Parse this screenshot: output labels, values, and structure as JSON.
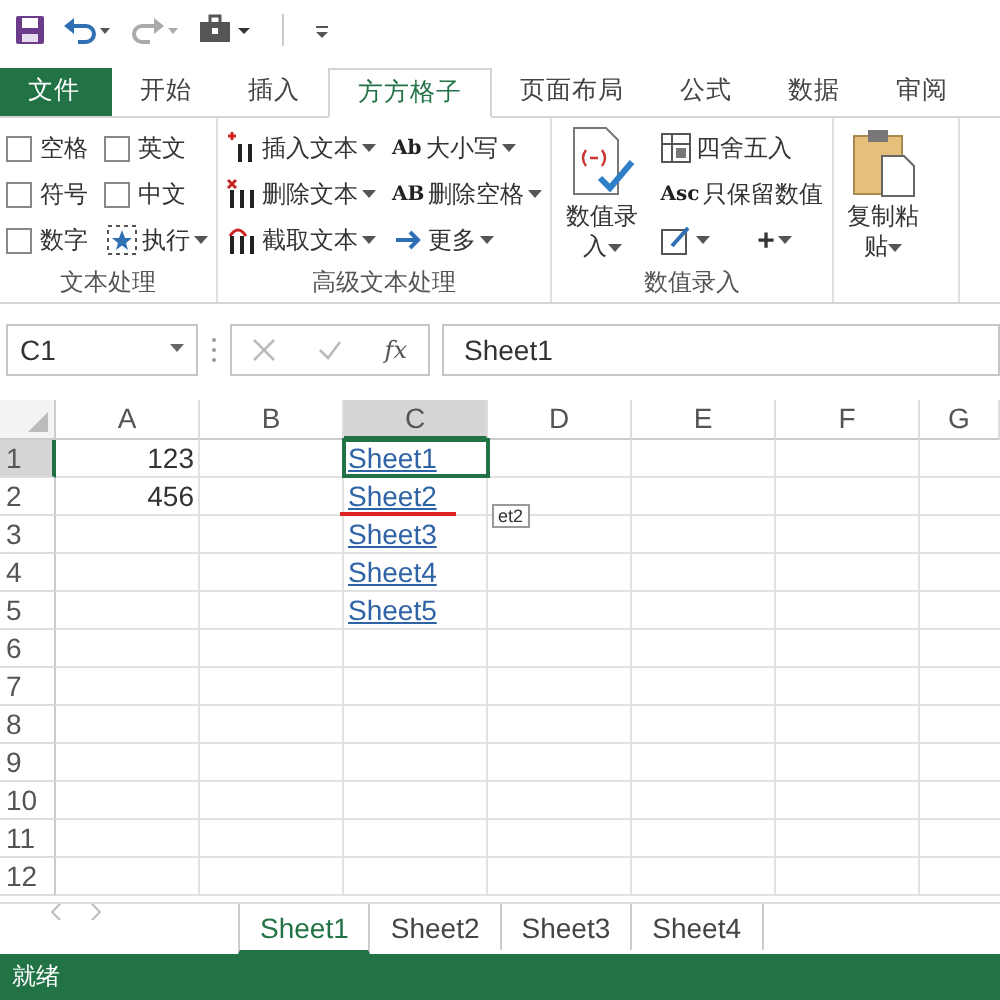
{
  "tabs": [
    {
      "label": "文件",
      "kind": "file",
      "selected": false
    },
    {
      "label": "开始",
      "kind": "tab",
      "selected": false
    },
    {
      "label": "插入",
      "kind": "tab",
      "selected": false
    },
    {
      "label": "方方格子",
      "kind": "tab",
      "selected": true
    },
    {
      "label": "页面布局",
      "kind": "tab",
      "selected": false
    },
    {
      "label": "公式",
      "kind": "tab",
      "selected": false
    },
    {
      "label": "数据",
      "kind": "tab",
      "selected": false
    },
    {
      "label": "审阅",
      "kind": "tab",
      "selected": false
    }
  ],
  "ribbon": [
    {
      "label": "文本处理",
      "kind": "checks",
      "items": [
        {
          "kind": "checkbox",
          "label": "空格",
          "checked": false
        },
        {
          "kind": "checkbox",
          "label": "英文",
          "checked": false
        },
        {
          "kind": "checkbox",
          "label": "符号",
          "checked": false
        },
        {
          "kind": "checkbox",
          "label": "中文",
          "checked": false
        },
        {
          "kind": "checkbox",
          "label": "数字",
          "checked": false
        },
        {
          "kind": "button",
          "label": "执行",
          "dropdown": true
        }
      ]
    },
    {
      "label": "高级文本处理",
      "kind": "columns",
      "items": [
        {
          "kind": "button",
          "label": "插入文本",
          "dropdown": true
        },
        {
          "kind": "button",
          "label": "删除文本",
          "dropdown": true
        },
        {
          "kind": "button",
          "label": "截取文本",
          "dropdown": true
        },
        {
          "kind": "button",
          "icon_text": "Ab",
          "label": "大小写",
          "dropdown": true
        },
        {
          "kind": "button",
          "icon_text": "AB",
          "label": "删除空格",
          "dropdown": true
        },
        {
          "kind": "button",
          "label": "更多",
          "dropdown": true
        }
      ]
    },
    {
      "label": "数值录入",
      "kind": "mixed",
      "items": [
        {
          "kind": "large",
          "label": "数值录入",
          "dropdown": true
        },
        {
          "kind": "button",
          "label": "四舍五入"
        },
        {
          "kind": "button",
          "icon_text": "Asc",
          "label": "只保留数值"
        },
        {
          "kind": "small",
          "dropdown": true
        },
        {
          "kind": "small",
          "label": "+",
          "dropdown": true
        }
      ]
    },
    {
      "kind": "mixed",
      "items": [
        {
          "kind": "large",
          "label": "复制粘贴",
          "dropdown": true
        }
      ]
    }
  ],
  "formula_bar": {
    "name_box": "C1",
    "function_label": "fx",
    "value": "Sheet1"
  },
  "sheet": {
    "columns": [
      {
        "label": "A",
        "selected": false
      },
      {
        "label": "B",
        "selected": false
      },
      {
        "label": "C",
        "selected": true
      },
      {
        "label": "D",
        "selected": false
      },
      {
        "label": "E",
        "selected": false
      },
      {
        "label": "F",
        "selected": false
      },
      {
        "label": "G",
        "selected": false
      }
    ],
    "rows": [
      {
        "label": "1",
        "selected": true,
        "A": {
          "text": "123",
          "kind": "number"
        },
        "C": {
          "text": "Sheet1",
          "kind": "link",
          "active": true
        }
      },
      {
        "label": "2",
        "selected": false,
        "A": {
          "text": "456",
          "kind": "number"
        },
        "C": {
          "text": "Sheet2",
          "kind": "link",
          "active": false
        }
      },
      {
        "label": "3",
        "selected": false,
        "C": {
          "text": "Sheet3",
          "kind": "link",
          "active": false,
          "tooltip": "et2"
        }
      },
      {
        "label": "4",
        "selected": false,
        "C": {
          "text": "Sheet4",
          "kind": "link",
          "active": false
        }
      },
      {
        "label": "5",
        "selected": false,
        "C": {
          "text": "Sheet5",
          "kind": "link",
          "active": false
        }
      },
      {
        "label": "6",
        "selected": false
      },
      {
        "label": "7",
        "selected": false
      },
      {
        "label": "8",
        "selected": false
      },
      {
        "label": "9",
        "selected": false
      },
      {
        "label": "10",
        "selected": false
      },
      {
        "label": "11",
        "selected": false
      },
      {
        "label": "12",
        "selected": false
      }
    ]
  },
  "sheet_tabs": [
    {
      "label": "Sheet1",
      "selected": true
    },
    {
      "label": "Sheet2",
      "selected": false
    },
    {
      "label": "Sheet3",
      "selected": false
    },
    {
      "label": "Sheet4",
      "selected": false
    }
  ],
  "status_bar": {
    "text": "就绪"
  }
}
